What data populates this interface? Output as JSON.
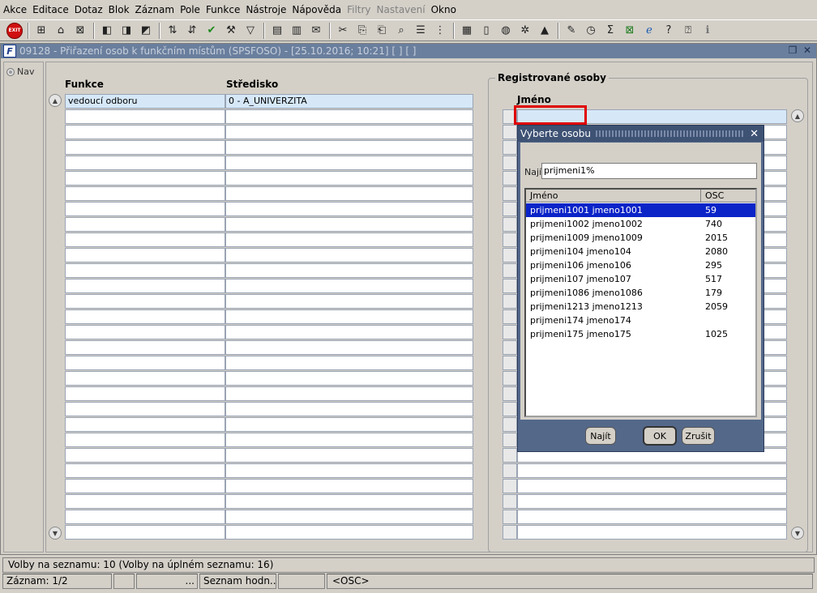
{
  "menubar": {
    "items": [
      {
        "label": "Akce",
        "disabled": false
      },
      {
        "label": "Editace",
        "disabled": false
      },
      {
        "label": "Dotaz",
        "disabled": false
      },
      {
        "label": "Blok",
        "disabled": false
      },
      {
        "label": "Záznam",
        "disabled": false
      },
      {
        "label": "Pole",
        "disabled": false
      },
      {
        "label": "Funkce",
        "disabled": false
      },
      {
        "label": "Nástroje",
        "disabled": false
      },
      {
        "label": "Nápověda",
        "disabled": false
      },
      {
        "label": "Filtry",
        "disabled": true
      },
      {
        "label": "Nastavení",
        "disabled": true
      },
      {
        "label": "Okno",
        "disabled": false
      }
    ]
  },
  "toolbar": {
    "exit_label": "EXIT"
  },
  "window": {
    "title": "09128 - Přiřazení osob k funkčním místům (SPSFOSO) - [25.10.2016; 10:21] [ ] [ ]",
    "nav_label": "Nav"
  },
  "funkce_block": {
    "col_funkce": "Funkce",
    "col_stredisko": "Středisko",
    "rows": [
      {
        "funkce": "vedoucí odboru",
        "stredisko": "0 - A_UNIVERZITA"
      }
    ]
  },
  "osoby_block": {
    "group_title": "Registrované osoby",
    "col_jmeno": "Jméno"
  },
  "dialog": {
    "title": "Vyberte osobu",
    "najit_label": "Najít",
    "najit_value": "prijmeni1%",
    "col_jmeno": "Jméno",
    "col_osc": "OSC",
    "rows": [
      {
        "jmeno": "prijmeni1001 jmeno1001",
        "osc": "59"
      },
      {
        "jmeno": "prijmeni1002 jmeno1002",
        "osc": "740"
      },
      {
        "jmeno": "prijmeni1009 jmeno1009",
        "osc": "2015"
      },
      {
        "jmeno": "prijmeni104 jmeno104",
        "osc": "2080"
      },
      {
        "jmeno": "prijmeni106 jmeno106",
        "osc": "295"
      },
      {
        "jmeno": "prijmeni107 jmeno107",
        "osc": "517"
      },
      {
        "jmeno": "prijmeni1086 jmeno1086",
        "osc": "179"
      },
      {
        "jmeno": "prijmeni1213 jmeno1213",
        "osc": "2059"
      },
      {
        "jmeno": "prijmeni174 jmeno174",
        "osc": ""
      },
      {
        "jmeno": "prijmeni175 jmeno175",
        "osc": "1025"
      }
    ],
    "btn_najit": "Najít",
    "btn_ok": "OK",
    "btn_zrusit": "Zrušit"
  },
  "status": {
    "line1": "Volby na seznamu: 10 (Volby na úplném seznamu: 16)",
    "zaznam": "Záznam: 1/2",
    "dots": "...",
    "seznam": "Seznam hodn...",
    "osc": "<OSC>"
  }
}
